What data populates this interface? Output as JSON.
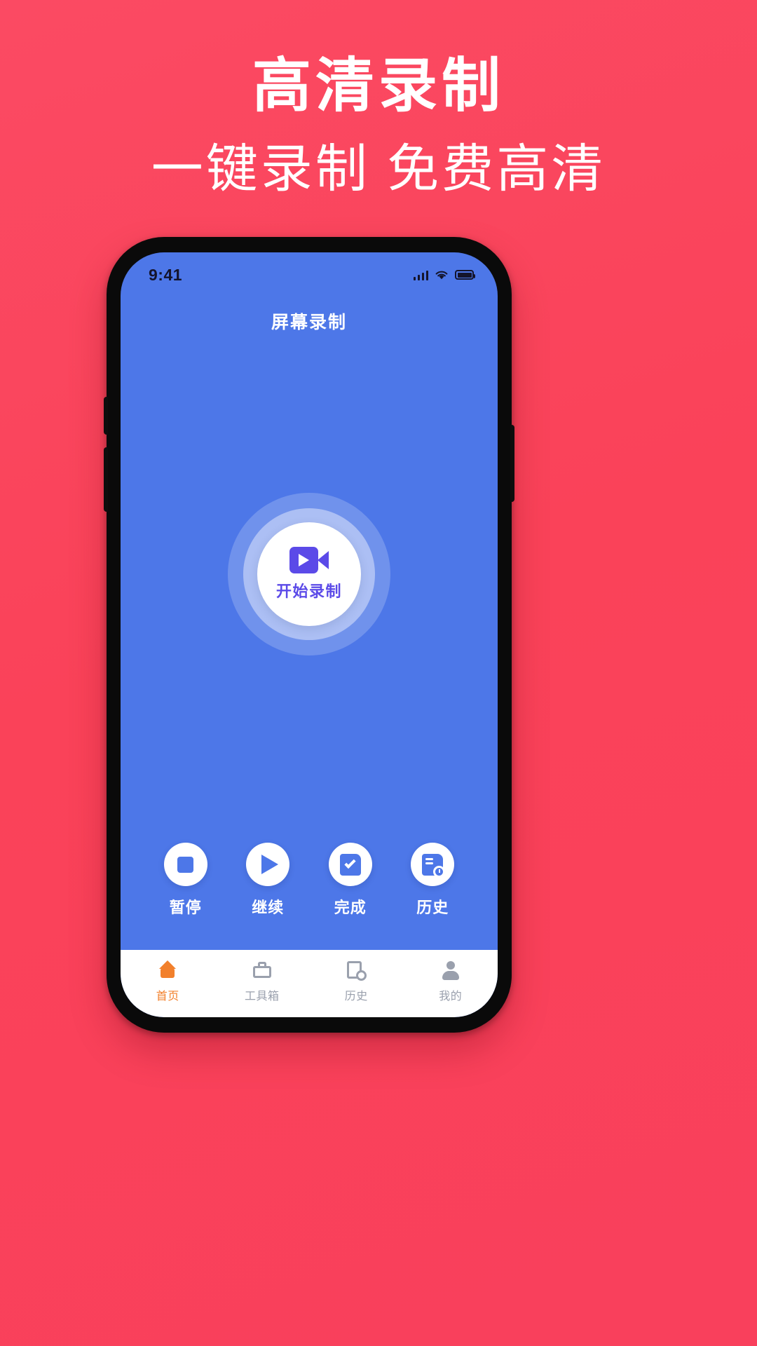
{
  "promo": {
    "title": "高清录制",
    "subtitle": "一键录制 免费高清"
  },
  "colors": {
    "background_top": "#fb4a63",
    "background_bottom": "#f9405c",
    "app_background": "#4d77e8",
    "accent_purple": "#5b4ae8",
    "tab_active": "#f2802c",
    "tab_inactive": "#9aa0ad"
  },
  "phone": {
    "statusbar": {
      "time": "9:41",
      "signal_icon": "cellular-signal-icon",
      "wifi_icon": "wifi-icon",
      "battery_icon": "battery-icon"
    },
    "app": {
      "title": "屏幕录制",
      "record_button": {
        "label": "开始录制",
        "icon": "video-camera-icon"
      },
      "actions": [
        {
          "label": "暂停",
          "icon": "stop-icon"
        },
        {
          "label": "继续",
          "icon": "play-icon"
        },
        {
          "label": "完成",
          "icon": "document-check-icon"
        },
        {
          "label": "历史",
          "icon": "document-clock-icon"
        }
      ],
      "tabs": [
        {
          "label": "首页",
          "icon": "home-icon",
          "active": true
        },
        {
          "label": "工具箱",
          "icon": "toolbox-icon",
          "active": false
        },
        {
          "label": "历史",
          "icon": "history-icon",
          "active": false
        },
        {
          "label": "我的",
          "icon": "user-icon",
          "active": false
        }
      ]
    }
  }
}
